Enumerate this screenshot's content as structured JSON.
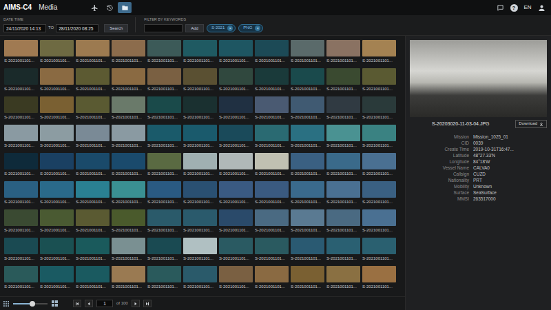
{
  "app": {
    "logo": "AIMS-C4",
    "title": "Media"
  },
  "modes": [
    {
      "selected": false
    },
    {
      "selected": false
    },
    {
      "selected": true
    }
  ],
  "header": {
    "help": "?",
    "language": "EN"
  },
  "filter": {
    "date_label": "DATE TIME",
    "from": "24/11/2020 14:13",
    "to_label": "TO",
    "to": "28/11/2020 08:25",
    "search": "Search",
    "keywords_label": "FILTER BY KEYWORDS",
    "add": "Add",
    "tags": [
      {
        "label": "S-2021",
        "remove": "×"
      },
      {
        "label": "PNG",
        "remove": "×"
      }
    ]
  },
  "thumbnails": [
    {
      "caption": "S-2021001101...",
      "color": "#a07a52"
    },
    {
      "caption": "S-2021001101...",
      "color": "#6e6a42"
    },
    {
      "caption": "S-2021001101...",
      "color": "#9c7a50"
    },
    {
      "caption": "S-2021001101...",
      "color": "#8c6c4c"
    },
    {
      "caption": "S-2021001101...",
      "color": "#3c5a58"
    },
    {
      "caption": "S-2021001101...",
      "color": "#1f5a62"
    },
    {
      "caption": "S-2021001101...",
      "color": "#1e5662"
    },
    {
      "caption": "S-2021001101...",
      "color": "#1c4a56"
    },
    {
      "caption": "S-2021001101...",
      "color": "#5a6a6a"
    },
    {
      "caption": "S-2021001101...",
      "color": "#8a7262"
    },
    {
      "caption": "S-2021001101...",
      "color": "#a48252"
    },
    {
      "caption": "S-2021001101...",
      "color": "#1a2a2a"
    },
    {
      "caption": "S-2021001101...",
      "color": "#8a6a42"
    },
    {
      "caption": "S-2021001101...",
      "color": "#5c5a32"
    },
    {
      "caption": "S-2021001101...",
      "color": "#8a6a42"
    },
    {
      "caption": "S-2021001101...",
      "color": "#7a6042"
    },
    {
      "caption": "S-2021001101...",
      "color": "#5a5032"
    },
    {
      "caption": "S-2021001101...",
      "color": "#30483e"
    },
    {
      "caption": "S-2021001101...",
      "color": "#1a3a3a"
    },
    {
      "caption": "S-2021001101...",
      "color": "#1a4a4c"
    },
    {
      "caption": "S-2021001101...",
      "color": "#3a4a30"
    },
    {
      "caption": "S-2021001101...",
      "color": "#5a5a32"
    },
    {
      "caption": "S-2021001101...",
      "color": "#3a3a22"
    },
    {
      "caption": "S-2021001101...",
      "color": "#7a6032"
    },
    {
      "caption": "S-2021001101...",
      "color": "#5a5a32"
    },
    {
      "caption": "S-2021001101...",
      "color": "#6a7a6a"
    },
    {
      "caption": "S-2021001101...",
      "color": "#1a4a4a"
    },
    {
      "caption": "S-2021001101...",
      "color": "#1a3030"
    },
    {
      "caption": "S-2021001101...",
      "color": "#203042"
    },
    {
      "caption": "S-2021001101...",
      "color": "#4a5a72"
    },
    {
      "caption": "S-2021001101...",
      "color": "#405a72"
    },
    {
      "caption": "S-2021001101...",
      "color": "#303a42"
    },
    {
      "caption": "S-2021001101...",
      "color": "#2a3a3a"
    },
    {
      "caption": "S-2021001101...",
      "color": "#8a9aa2"
    },
    {
      "caption": "S-2021001101...",
      "color": "#8c9ca2"
    },
    {
      "caption": "S-2021001101...",
      "color": "#7a8a96"
    },
    {
      "caption": "S-2021001101...",
      "color": "#8a9aa2"
    },
    {
      "caption": "S-2021001101...",
      "color": "#1a5a6a"
    },
    {
      "caption": "S-2021001101...",
      "color": "#1a5a6c"
    },
    {
      "caption": "S-2021001101...",
      "color": "#1a4a5a"
    },
    {
      "caption": "S-2021001101...",
      "color": "#2a6a72"
    },
    {
      "caption": "S-2021001101...",
      "color": "#2a7082"
    },
    {
      "caption": "S-2021001101...",
      "color": "#4a9292"
    },
    {
      "caption": "S-2021001101...",
      "color": "#3a8282"
    },
    {
      "caption": "S-2021001101...",
      "color": "#0e2a3a"
    },
    {
      "caption": "S-2021001101...",
      "color": "#1a4062"
    },
    {
      "caption": "S-2021001101...",
      "color": "#1a4a6a"
    },
    {
      "caption": "S-2021001101...",
      "color": "#1a4a6c"
    },
    {
      "caption": "S-2021001101...",
      "color": "#5a6a42"
    },
    {
      "caption": "S-2021001101...",
      "color": "#a0b0b2"
    },
    {
      "caption": "S-2021001101...",
      "color": "#b0b8b8"
    },
    {
      "caption": "S-2021001101...",
      "color": "#c0c0b2"
    },
    {
      "caption": "S-2021001101...",
      "color": "#3a6082"
    },
    {
      "caption": "S-2021001101...",
      "color": "#3a6a8a"
    },
    {
      "caption": "S-2021001101...",
      "color": "#4a7092"
    },
    {
      "caption": "S-2021001101...",
      "color": "#2a6082"
    },
    {
      "caption": "S-2021001101...",
      "color": "#2a6a8a"
    },
    {
      "caption": "S-2021001101...",
      "color": "#2a8092"
    },
    {
      "caption": "S-2021001101...",
      "color": "#3a9092"
    },
    {
      "caption": "S-2021001101...",
      "color": "#2a5a82"
    },
    {
      "caption": "S-2021001101...",
      "color": "#2a5072"
    },
    {
      "caption": "S-2021001101...",
      "color": "#3a5a82"
    },
    {
      "caption": "S-2021001101...",
      "color": "#3a5a80"
    },
    {
      "caption": "S-2021001101...",
      "color": "#3a6a8c"
    },
    {
      "caption": "S-2021001101...",
      "color": "#4a7092"
    },
    {
      "caption": "S-2021001101...",
      "color": "#3a6082"
    },
    {
      "caption": "S-2021001101...",
      "color": "#3a4a32"
    },
    {
      "caption": "S-2021001101...",
      "color": "#4a5a32"
    },
    {
      "caption": "S-2021001101...",
      "color": "#5a5a32"
    },
    {
      "caption": "S-2021001101...",
      "color": "#4a5a2c"
    },
    {
      "caption": "S-2021001101...",
      "color": "#2a5a6a"
    },
    {
      "caption": "S-2021001101...",
      "color": "#2a5a6c"
    },
    {
      "caption": "S-2021001101...",
      "color": "#2a4a6a"
    },
    {
      "caption": "S-2021001101...",
      "color": "#4a6a82"
    },
    {
      "caption": "S-2021001101...",
      "color": "#5a7a92"
    },
    {
      "caption": "S-2021001101...",
      "color": "#4a6a82"
    },
    {
      "caption": "S-2021001101...",
      "color": "#4a7092"
    },
    {
      "caption": "S-2021001101...",
      "color": "#1a4a52"
    },
    {
      "caption": "S-2021001101...",
      "color": "#1a5052"
    },
    {
      "caption": "S-2021001101...",
      "color": "#1a5a5c"
    },
    {
      "caption": "S-2021001101...",
      "color": "#7a9092"
    },
    {
      "caption": "S-2021001101...",
      "color": "#1a4a52"
    },
    {
      "caption": "S-2021001101...",
      "color": "#b0c0c2"
    },
    {
      "caption": "S-2021001101...",
      "color": "#2a5a62"
    },
    {
      "caption": "S-2021001101...",
      "color": "#2a5a60"
    },
    {
      "caption": "S-2021001101...",
      "color": "#2a5a72"
    },
    {
      "caption": "S-2021001101...",
      "color": "#2a6072"
    },
    {
      "caption": "S-2021001101...",
      "color": "#2a6070"
    },
    {
      "caption": "S-2021001101...",
      "color": "#2a5a5a"
    },
    {
      "caption": "S-2021001101...",
      "color": "#1a5a62"
    },
    {
      "caption": "S-2021001101...",
      "color": "#1a5a60"
    },
    {
      "caption": "S-2021001101...",
      "color": "#9a7a52"
    },
    {
      "caption": "S-2021001101...",
      "color": "#2a5a5c"
    },
    {
      "caption": "S-2021001101...",
      "color": "#2a5a6a"
    },
    {
      "caption": "S-2021001101...",
      "color": "#7a6042"
    },
    {
      "caption": "S-2021001101...",
      "color": "#8a6a42"
    },
    {
      "caption": "S-2021001101...",
      "color": "#7a6032"
    },
    {
      "caption": "S-2021001101...",
      "color": "#8a7042"
    },
    {
      "caption": "S-2021001101...",
      "color": "#9a7042"
    }
  ],
  "size_slider": {
    "level": 0.55
  },
  "pagination": {
    "page": "1",
    "of": "of 100"
  },
  "detail": {
    "filename": "S-20203020-11-03-04.JPG",
    "download": "Download",
    "fields": [
      {
        "label": "Mission",
        "value": "Mission_1025_01"
      },
      {
        "label": "CID",
        "value": "0039"
      },
      {
        "label": "Create Time",
        "value": "2019-10-31T16:47..."
      },
      {
        "label": "Latitude",
        "value": "48°27.33'N"
      },
      {
        "label": "Longitude",
        "value": "84°18'W"
      },
      {
        "label": "Vessel Name",
        "value": "CALVA0"
      },
      {
        "label": "Callsign",
        "value": "CUZD"
      },
      {
        "label": "Nationality",
        "value": "PRT"
      },
      {
        "label": "Mobility",
        "value": "Unknown"
      },
      {
        "label": "Surface",
        "value": "SeaSurface"
      },
      {
        "label": "MMSI",
        "value": "263517000"
      }
    ]
  }
}
